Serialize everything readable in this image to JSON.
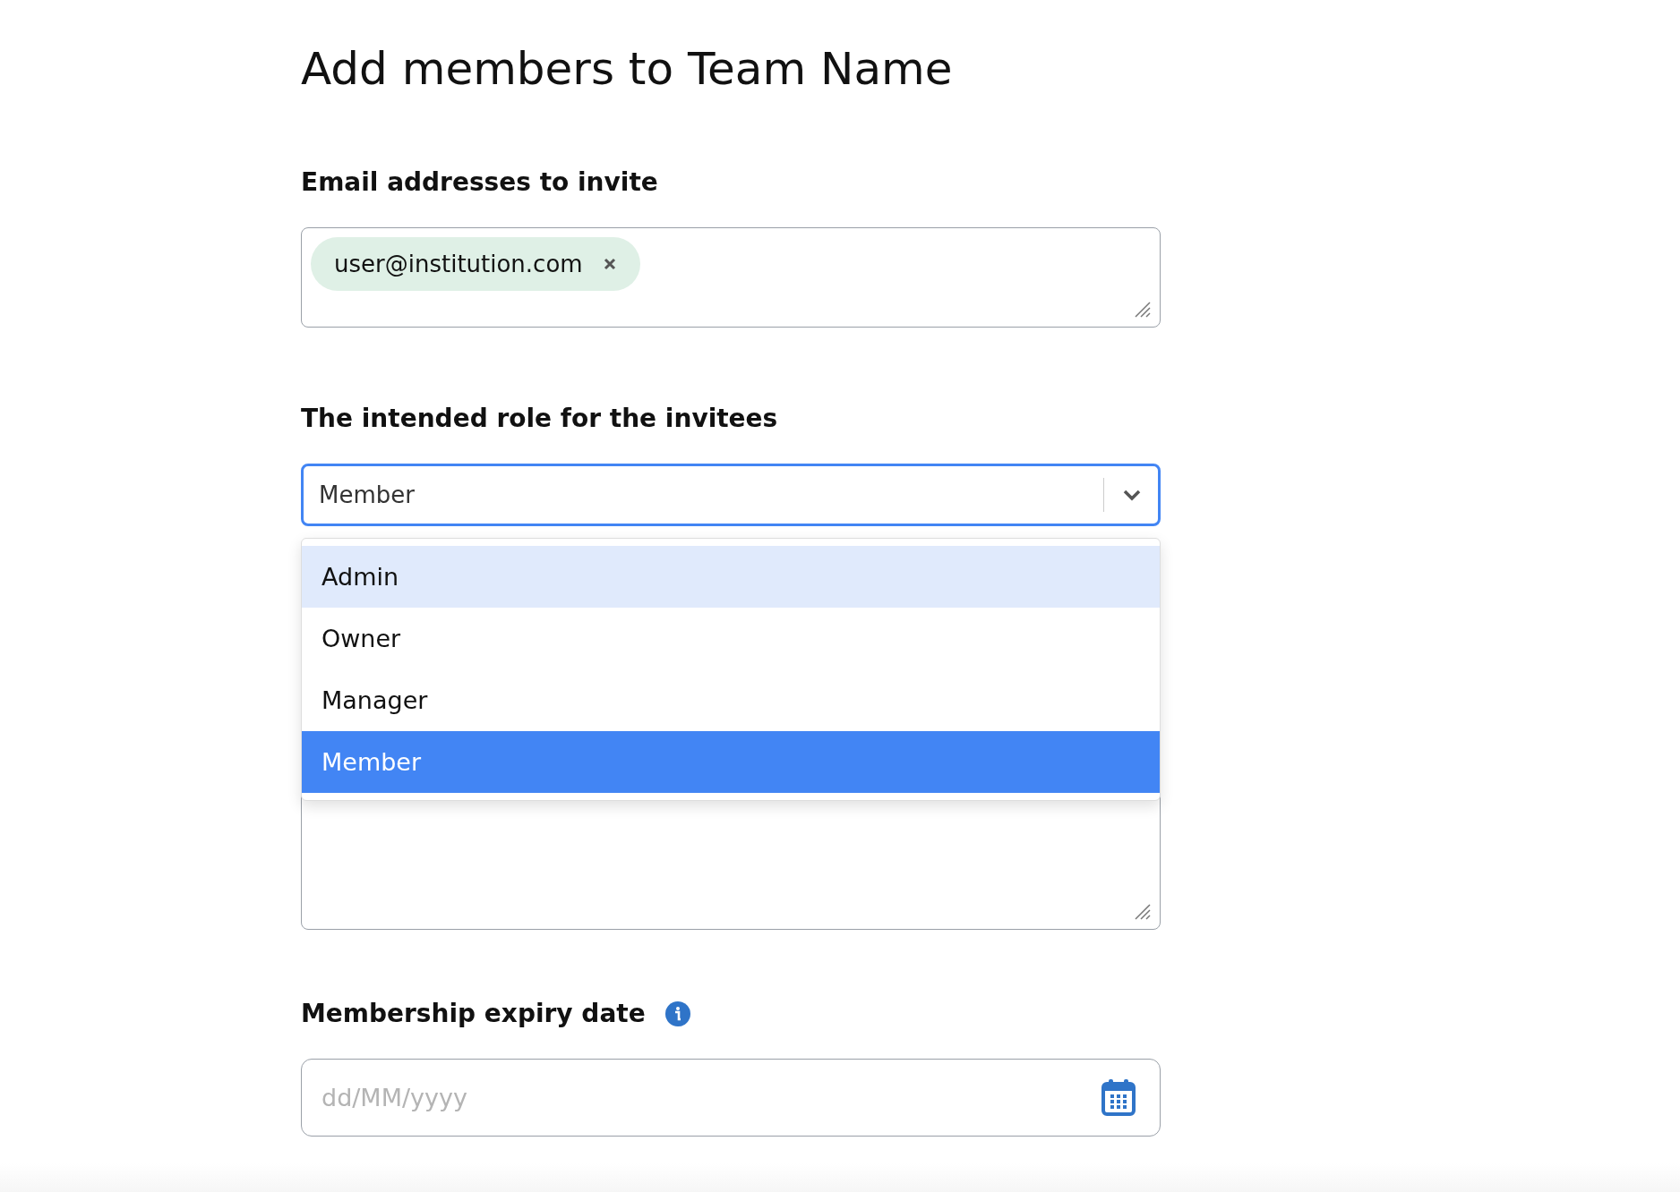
{
  "title": "Add members to Team Name",
  "email": {
    "label": "Email addresses to invite",
    "chips": [
      {
        "text": "user@institution.com"
      }
    ]
  },
  "role": {
    "label": "The intended role for the invitees",
    "value": "Member",
    "expanded": true,
    "options": [
      {
        "label": "Admin",
        "selected": false,
        "highlighted": true
      },
      {
        "label": "Owner",
        "selected": false,
        "highlighted": false
      },
      {
        "label": "Manager",
        "selected": false,
        "highlighted": false
      },
      {
        "label": "Member",
        "selected": true,
        "highlighted": false
      }
    ]
  },
  "expiry": {
    "label": "Membership expiry date",
    "placeholder": "dd/MM/yyyy"
  }
}
